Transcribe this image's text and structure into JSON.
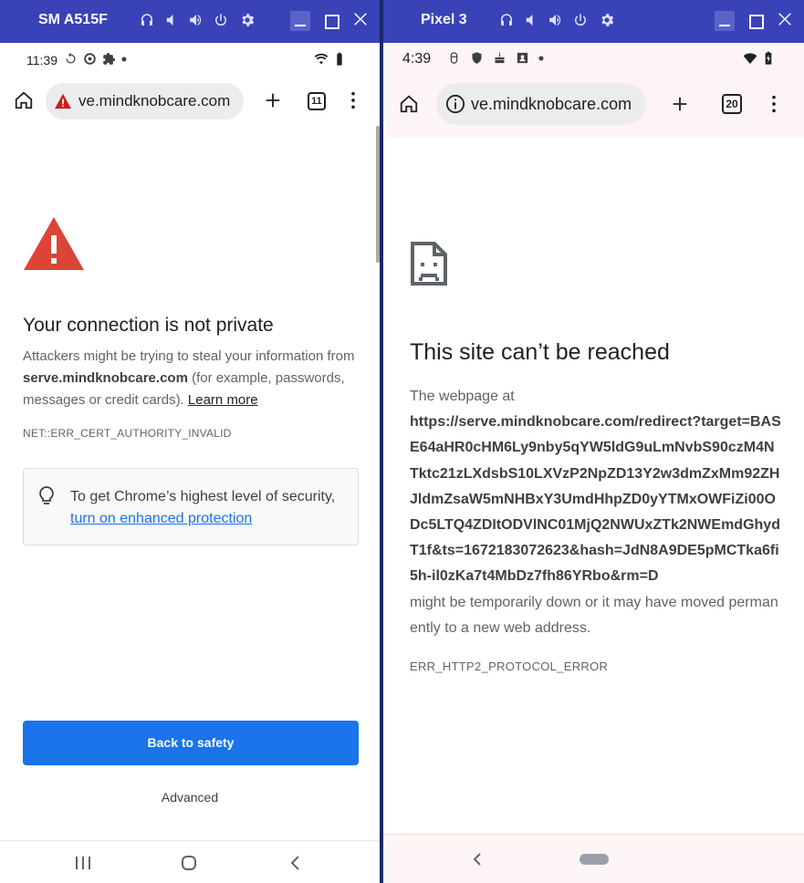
{
  "left_window": {
    "device_name": "SM A515F",
    "status": {
      "time": "11:39"
    },
    "browser": {
      "url": "ve.mindknobcare.com",
      "tab_count": "11"
    },
    "page": {
      "heading": "Your connection is not private",
      "body_prefix": "Attackers might be trying to steal your information from ",
      "domain": "serve.mindknobcare.com",
      "body_suffix": " (for example, passwords, messages or credit cards). ",
      "learn_more": "Learn more",
      "error_code": "NET::ERR_CERT_AUTHORITY_INVALID",
      "tip_text": "To get Chrome’s highest level of security,",
      "tip_link": "turn on enhanced protection",
      "back_button": "Back to safety",
      "advanced": "Advanced"
    },
    "colors": {
      "titlebar": "#3943b7",
      "primary_button": "#1a73e8",
      "warning": "#d93025"
    }
  },
  "right_window": {
    "device_name": "Pixel 3",
    "status": {
      "time": "4:39"
    },
    "browser": {
      "url": "ve.mindknobcare.com",
      "tab_count": "20"
    },
    "page": {
      "heading": "This site can’t be reached",
      "intro": "The webpage at",
      "long_url": "https://serve.mindknobcare.com/redirect?target=BASE64aHR0cHM6Ly9nby5qYW5ldG9uLmNvbS90czM4NTktc21zLXdsbS10LXVzP2NpZD13Y2w3dmZxMm92ZHJldmZsaW5mNHBxY3UmdHhpZD0yYTMxOWFiZi00ODc5LTQ4ZDItODVlNC01MjQ2NWUxZTk2NWEmdGhydT1f&ts=1672183072623&hash=JdN8A9DE5pMCTka6fi5h-il0zKa7t4MbDz7fh86YRbo&rm=D",
      "outro": "might be temporarily down or it may have moved permanently to a new web address.",
      "error_code": "ERR_HTTP2_PROTOCOL_ERROR"
    }
  }
}
